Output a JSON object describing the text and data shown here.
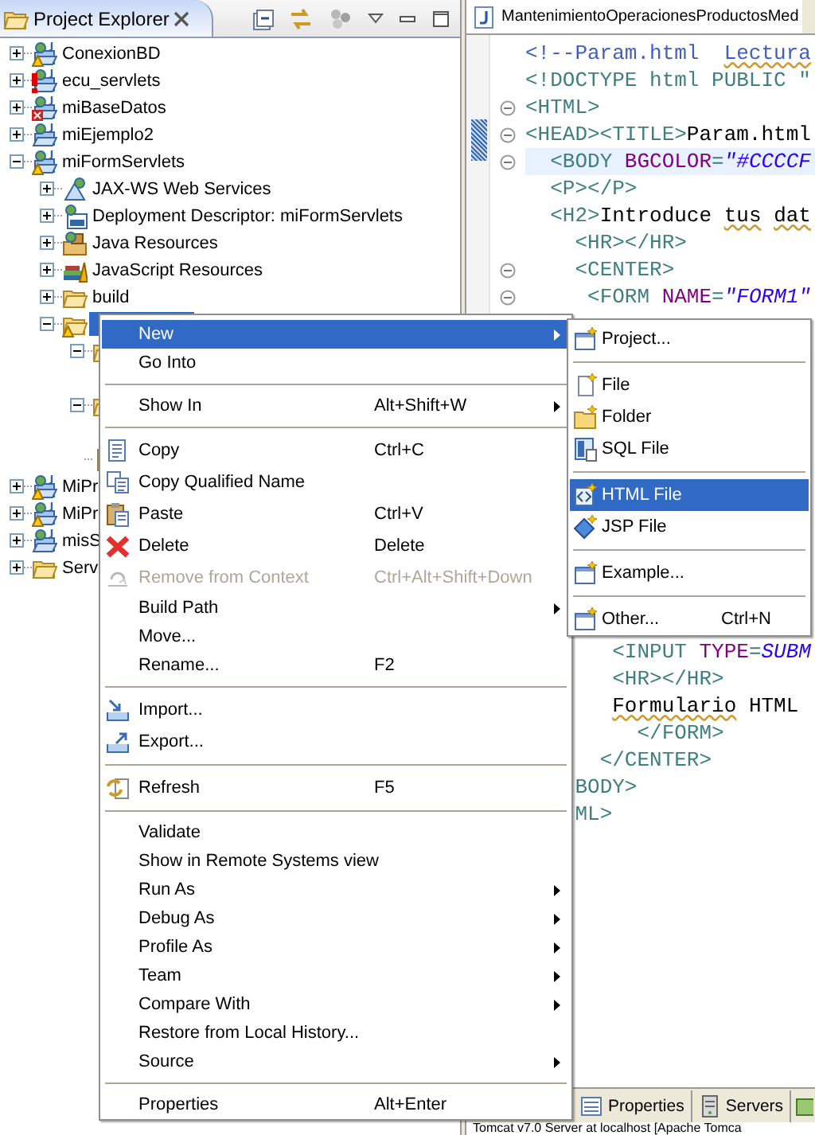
{
  "explorer": {
    "title": "Project Explorer",
    "tree": [
      {
        "label": "ConexionBD",
        "kind": "project-warning",
        "expanded": false,
        "selected": false
      },
      {
        "label": "ecu_servlets",
        "kind": "project-error",
        "expanded": false,
        "selected": false
      },
      {
        "label": "miBaseDatos",
        "kind": "project-failed",
        "expanded": false,
        "selected": false
      },
      {
        "label": "miEjemplo2",
        "kind": "project",
        "expanded": false,
        "selected": false
      },
      {
        "label": "miFormServlets",
        "kind": "project-warning",
        "expanded": true,
        "selected": false,
        "children": [
          {
            "label": "JAX-WS Web Services",
            "kind": "web-services",
            "expanded": false,
            "selected": false
          },
          {
            "label": "Deployment Descriptor: miFormServlets",
            "kind": "descriptor",
            "expanded": false,
            "selected": false
          },
          {
            "label": "Java Resources",
            "kind": "java-resources",
            "expanded": false,
            "selected": false
          },
          {
            "label": "JavaScript Resources",
            "kind": "js-resources",
            "expanded": false,
            "selected": false
          },
          {
            "label": "build",
            "kind": "folder",
            "expanded": false,
            "selected": false
          },
          {
            "kind": "folder-warning",
            "expanded": true,
            "selected": true,
            "children": [
              {
                "kind": "folder",
                "expanded": true
              },
              {
                "kind": "folder",
                "expanded": true
              },
              {
                "kind": "file"
              }
            ]
          }
        ]
      },
      {
        "label": "MiPr",
        "kind": "project-warning",
        "expanded": false,
        "selected": false
      },
      {
        "label": "MiPr",
        "kind": "project-warning",
        "expanded": false,
        "selected": false
      },
      {
        "label": "misS",
        "kind": "project",
        "expanded": false,
        "selected": false
      },
      {
        "label": "Serv",
        "kind": "folder",
        "expanded": false,
        "selected": false
      }
    ]
  },
  "editor": {
    "tab": "MantenimientoOperacionesProductosMed",
    "lines": [
      {
        "foldable": false,
        "current": false,
        "tokens": [
          {
            "kind": "comment",
            "text": "<!--Param.html  "
          },
          {
            "kind": "spell-comment",
            "text": "Lectura"
          }
        ]
      },
      {
        "foldable": false,
        "current": false,
        "tokens": [
          {
            "kind": "doctype",
            "text": "<!DOCTYPE html PUBLIC \""
          }
        ]
      },
      {
        "foldable": true,
        "current": false,
        "tokens": [
          {
            "kind": "tag",
            "text": "<HTML>"
          }
        ]
      },
      {
        "foldable": true,
        "current": false,
        "tokens": [
          {
            "kind": "tag",
            "text": "<HEAD><TITLE>"
          },
          {
            "kind": "text",
            "text": "Param.html"
          }
        ]
      },
      {
        "foldable": true,
        "current": true,
        "tokens": [
          {
            "kind": "tag",
            "text": "  <BODY "
          },
          {
            "kind": "attr",
            "text": "BGCOLOR"
          },
          {
            "kind": "tag",
            "text": "="
          },
          {
            "kind": "value",
            "text": "\"#CCCCF"
          }
        ]
      },
      {
        "foldable": false,
        "current": false,
        "tokens": [
          {
            "kind": "tag",
            "text": "  <P></P>"
          }
        ]
      },
      {
        "foldable": false,
        "current": false,
        "tokens": [
          {
            "kind": "tag",
            "text": "  <H2>"
          },
          {
            "kind": "text",
            "text": "Introduce "
          },
          {
            "kind": "spell-text",
            "text": "tus"
          },
          {
            "kind": "spell-text",
            "text": " dat"
          }
        ]
      },
      {
        "foldable": false,
        "current": false,
        "tokens": [
          {
            "kind": "tag",
            "text": "    <HR></HR>"
          }
        ]
      },
      {
        "foldable": true,
        "current": false,
        "tokens": [
          {
            "kind": "tag",
            "text": "    <CENTER>"
          }
        ]
      },
      {
        "foldable": true,
        "current": false,
        "tokens": [
          {
            "kind": "tag",
            "text": "     <FORM "
          },
          {
            "kind": "attr",
            "text": "NAME"
          },
          {
            "kind": "tag",
            "text": "="
          },
          {
            "kind": "value",
            "text": "\"FORM1\""
          }
        ]
      }
    ],
    "lower_lines": [
      {
        "current": false,
        "tokens": [
          {
            "kind": "tag",
            "text": "       <INPUT "
          },
          {
            "kind": "attr",
            "text": "TYPE"
          },
          {
            "kind": "tag",
            "text": "="
          },
          {
            "kind": "value",
            "text": "SUBM"
          }
        ]
      },
      {
        "current": false,
        "tokens": [
          {
            "kind": "tag",
            "text": "       <HR></HR>"
          }
        ]
      },
      {
        "current": false,
        "tokens": [
          {
            "kind": "spell-text",
            "text": "       Formulario"
          },
          {
            "kind": "text",
            "text": " HTML"
          }
        ]
      },
      {
        "current": false,
        "tokens": [
          {
            "kind": "tag",
            "text": "         </FORM>"
          }
        ]
      },
      {
        "current": false,
        "tokens": [
          {
            "kind": "tag",
            "text": "      </CENTER>"
          }
        ]
      },
      {
        "current": false,
        "tokens": [
          {
            "kind": "tag",
            "text": "    BODY>"
          }
        ]
      },
      {
        "current": false,
        "tokens": [
          {
            "kind": "tag",
            "text": "    ML>"
          }
        ]
      }
    ]
  },
  "views": {
    "tabs": [
      {
        "label": "Properties",
        "selected": false
      },
      {
        "label": "Servers",
        "selected": false
      }
    ],
    "status": "Tomcat v7.0 Server at localhost [Apache Tomca"
  },
  "menu": {
    "items": [
      {
        "kind": "item",
        "label": "New",
        "submenu": true,
        "selected": true,
        "disabled": false
      },
      {
        "kind": "item",
        "label": "Go Into",
        "submenu": false,
        "selected": false,
        "disabled": false
      },
      {
        "kind": "separator"
      },
      {
        "kind": "item",
        "label": "Show In",
        "shortcut": "Alt+Shift+W",
        "submenu": true,
        "selected": false,
        "disabled": false
      },
      {
        "kind": "separator"
      },
      {
        "kind": "item",
        "label": "Copy",
        "shortcut": "Ctrl+C",
        "submenu": false,
        "selected": false,
        "disabled": false
      },
      {
        "kind": "item",
        "label": "Copy Qualified Name",
        "submenu": false,
        "selected": false,
        "disabled": false
      },
      {
        "kind": "item",
        "label": "Paste",
        "shortcut": "Ctrl+V",
        "submenu": false,
        "selected": false,
        "disabled": false
      },
      {
        "kind": "item",
        "label": "Delete",
        "shortcut": "Delete",
        "submenu": false,
        "selected": false,
        "disabled": false
      },
      {
        "kind": "item",
        "label": "Remove from Context",
        "shortcut": "Ctrl+Alt+Shift+Down",
        "submenu": false,
        "selected": false,
        "disabled": true
      },
      {
        "kind": "item",
        "label": "Build Path",
        "submenu": true,
        "selected": false,
        "disabled": false
      },
      {
        "kind": "item",
        "label": "Move...",
        "submenu": false,
        "selected": false,
        "disabled": false
      },
      {
        "kind": "item",
        "label": "Rename...",
        "shortcut": "F2",
        "submenu": false,
        "selected": false,
        "disabled": false
      },
      {
        "kind": "separator"
      },
      {
        "kind": "item",
        "label": "Import...",
        "submenu": false,
        "selected": false,
        "disabled": false
      },
      {
        "kind": "item",
        "label": "Export...",
        "submenu": false,
        "selected": false,
        "disabled": false
      },
      {
        "kind": "separator"
      },
      {
        "kind": "item",
        "label": "Refresh",
        "shortcut": "F5",
        "submenu": false,
        "selected": false,
        "disabled": false
      },
      {
        "kind": "separator"
      },
      {
        "kind": "item",
        "label": "Validate",
        "submenu": false,
        "selected": false,
        "disabled": false
      },
      {
        "kind": "item",
        "label": "Show in Remote Systems view",
        "submenu": false,
        "selected": false,
        "disabled": false
      },
      {
        "kind": "item",
        "label": "Run As",
        "submenu": true,
        "selected": false,
        "disabled": false
      },
      {
        "kind": "item",
        "label": "Debug As",
        "submenu": true,
        "selected": false,
        "disabled": false
      },
      {
        "kind": "item",
        "label": "Profile As",
        "submenu": true,
        "selected": false,
        "disabled": false
      },
      {
        "kind": "item",
        "label": "Team",
        "submenu": true,
        "selected": false,
        "disabled": false
      },
      {
        "kind": "item",
        "label": "Compare With",
        "submenu": true,
        "selected": false,
        "disabled": false
      },
      {
        "kind": "item",
        "label": "Restore from Local History...",
        "submenu": false,
        "selected": false,
        "disabled": false
      },
      {
        "kind": "item",
        "label": "Source",
        "submenu": true,
        "selected": false,
        "disabled": false
      },
      {
        "kind": "separator"
      },
      {
        "kind": "item",
        "label": "Properties",
        "shortcut": "Alt+Enter",
        "submenu": false,
        "selected": false,
        "disabled": false
      }
    ]
  },
  "submenu": {
    "items": [
      {
        "kind": "item",
        "label": "Project...",
        "selected": false
      },
      {
        "kind": "separator"
      },
      {
        "kind": "item",
        "label": "File",
        "selected": false
      },
      {
        "kind": "item",
        "label": "Folder",
        "selected": false
      },
      {
        "kind": "item",
        "label": "SQL File",
        "selected": false
      },
      {
        "kind": "separator"
      },
      {
        "kind": "item",
        "label": "HTML File",
        "selected": true
      },
      {
        "kind": "item",
        "label": "JSP File",
        "selected": false
      },
      {
        "kind": "separator"
      },
      {
        "kind": "item",
        "label": "Example...",
        "selected": false
      },
      {
        "kind": "separator"
      },
      {
        "kind": "item",
        "label": "Other...",
        "shortcut": "Ctrl+N",
        "selected": false
      }
    ]
  }
}
